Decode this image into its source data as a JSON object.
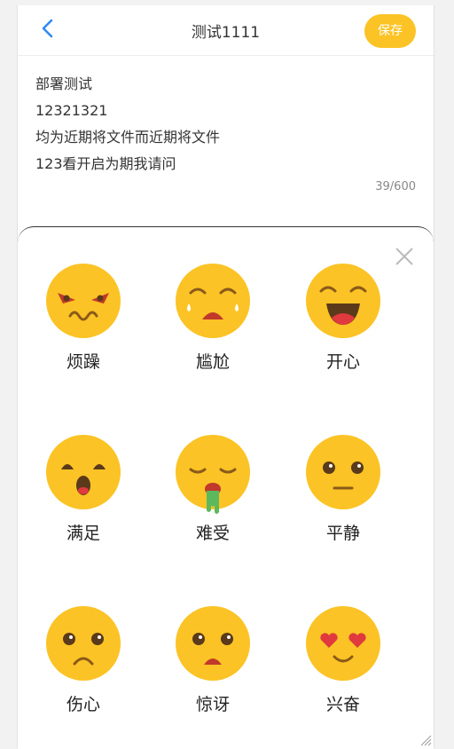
{
  "header": {
    "title": "测试1111",
    "save_label": "保存"
  },
  "note": {
    "lines": [
      "部署测试",
      "12321321",
      "均为近期将文件而近期将文件",
      "123看开启为期我请问"
    ],
    "char_count": "39/600"
  },
  "emotions": [
    {
      "label": "烦躁",
      "icon": "irritated-face-icon"
    },
    {
      "label": "尴尬",
      "icon": "embarrassed-face-icon"
    },
    {
      "label": "开心",
      "icon": "happy-face-icon"
    },
    {
      "label": "满足",
      "icon": "satisfied-face-icon"
    },
    {
      "label": "难受",
      "icon": "sick-face-icon"
    },
    {
      "label": "平静",
      "icon": "calm-face-icon"
    },
    {
      "label": "伤心",
      "icon": "sad-face-icon"
    },
    {
      "label": "惊讶",
      "icon": "surprised-face-icon"
    },
    {
      "label": "兴奋",
      "icon": "excited-face-icon"
    }
  ],
  "colors": {
    "accent": "#fbc325",
    "face": "#fbc325",
    "back_arrow": "#2f8af5"
  }
}
